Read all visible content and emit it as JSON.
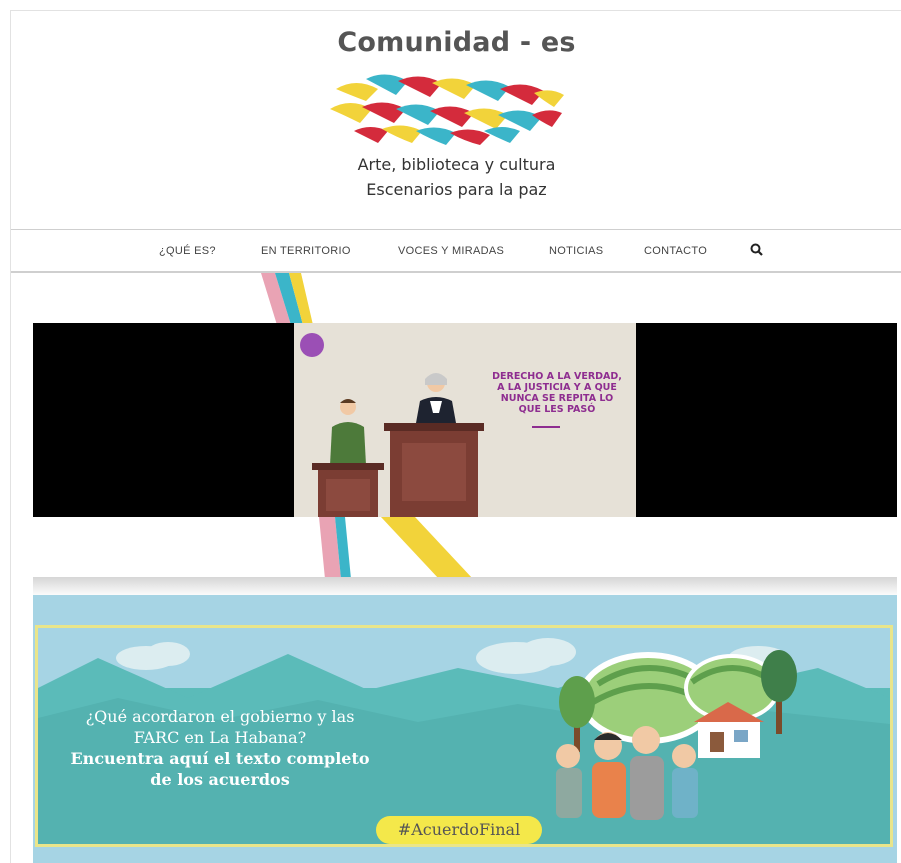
{
  "header": {
    "site_title": "Comunidad - es",
    "tagline_line1": "Arte, biblioteca y cultura",
    "tagline_line2": "Escenarios para la paz"
  },
  "nav": {
    "items": [
      {
        "label": "¿QUÉ ES?"
      },
      {
        "label": "EN TERRITORIO"
      },
      {
        "label": "VOCES Y MIRADAS"
      },
      {
        "label": "NOTICIAS"
      },
      {
        "label": "CONTACTO"
      }
    ],
    "search_icon": "search-icon"
  },
  "hero": {
    "caption_lines": [
      "DERECHO A LA VERDAD,",
      "A LA JUSTICIA Y A QUE",
      "NUNCA SE REPITA LO",
      "QUE LES PASÓ"
    ]
  },
  "banner": {
    "line1": "¿Qué acordaron el gobierno y las",
    "line2": "FARC en La Habana?",
    "line3": "Encuentra aquí el texto completo",
    "line4": "de los acuerdos",
    "hashtag": "#AcuerdoFinal"
  },
  "colors": {
    "braid_yellow": "#f2d33a",
    "braid_red": "#d42b3c",
    "braid_teal": "#3bb5c9",
    "braid_pink": "#e9a3b4",
    "banner_teal": "#5bbbb9",
    "banner_sky": "#a6d4e4",
    "hashtag_yellow": "#f4e84a",
    "hero_purple": "#8e2d90"
  }
}
